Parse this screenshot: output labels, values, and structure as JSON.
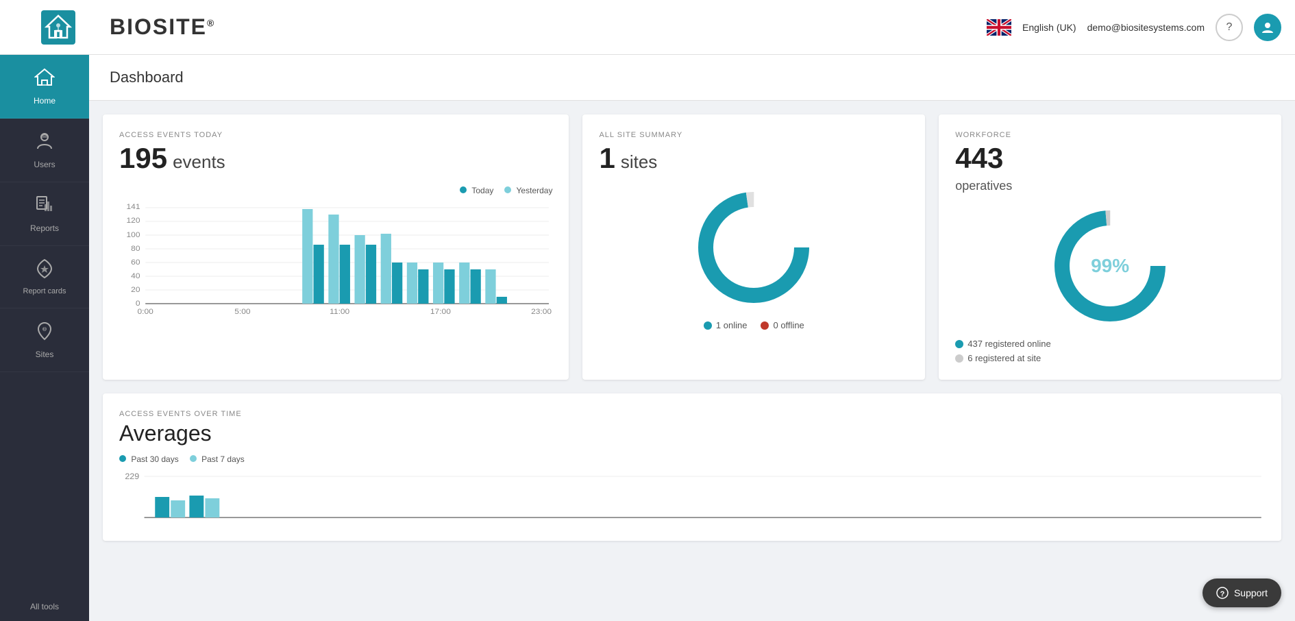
{
  "header": {
    "logo": "BIOSITE",
    "logo_reg": "®",
    "language": "English (UK)",
    "user_email": "demo@biositesystems.com",
    "help_icon": "?",
    "user_icon": "👤"
  },
  "sidebar": {
    "items": [
      {
        "id": "home",
        "label": "Home",
        "icon": "🏠",
        "active": true
      },
      {
        "id": "users",
        "label": "Users",
        "icon": "👷",
        "active": false
      },
      {
        "id": "reports",
        "label": "Reports",
        "icon": "📋",
        "active": false
      },
      {
        "id": "report-cards",
        "label": "Report cards",
        "icon": "⭐",
        "active": false
      },
      {
        "id": "sites",
        "label": "Sites",
        "icon": "📍",
        "active": false
      }
    ],
    "all_tools_label": "All tools"
  },
  "page": {
    "title": "Dashboard"
  },
  "access_events": {
    "subtitle": "ACCESS EVENTS TODAY",
    "count": "195",
    "label": "events",
    "legend_today": "Today",
    "legend_yesterday": "Yesterday",
    "y_labels": [
      "141",
      "120",
      "100",
      "80",
      "60",
      "40",
      "20",
      "0"
    ],
    "x_labels": [
      "0:00",
      "5:00",
      "11:00",
      "17:00",
      "23:00"
    ]
  },
  "all_site_summary": {
    "subtitle": "ALL SITE SUMMARY",
    "count": "1",
    "label": "sites",
    "online_count": "1",
    "online_label": "online",
    "offline_count": "0",
    "offline_label": "offline",
    "online_color": "#1a9bb0",
    "offline_color": "#c0392b"
  },
  "workforce": {
    "subtitle": "WORKFORCE",
    "count": "443",
    "label": "operatives",
    "percentage": "99%",
    "registered_online_count": "437",
    "registered_online_label": "registered online",
    "registered_at_site_count": "6",
    "registered_at_site_label": "registered at site",
    "online_color": "#1a9bb0",
    "site_color": "#ccc"
  },
  "averages": {
    "subtitle": "ACCESS EVENTS OVER TIME",
    "title": "Averages",
    "legend_30": "Past 30 days",
    "legend_7": "Past 7 days",
    "y_label": "229"
  },
  "support": {
    "label": "Support",
    "icon": "?"
  },
  "colors": {
    "teal": "#1a9bb0",
    "light_teal": "#7ecfdb",
    "dark_bg": "#2a2d3a",
    "active_bg": "#1a8fa0"
  }
}
